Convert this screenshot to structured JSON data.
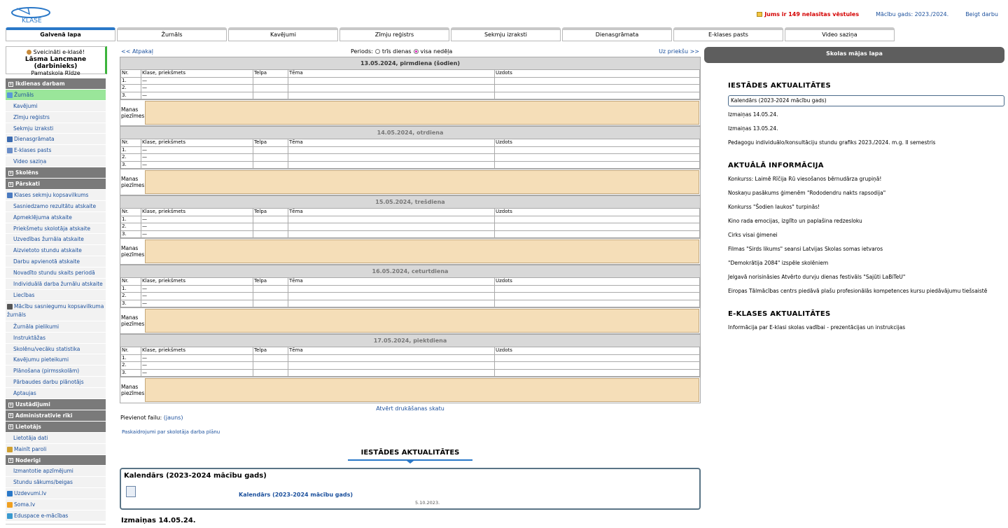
{
  "header": {
    "logo_text": "KLASE",
    "messages": "Jums ir 149 nelasītas vēstules",
    "school_year": "Mācību gads: 2023./2024.",
    "logout": "Beigt darbu"
  },
  "tabs": [
    {
      "label": "Galvenā lapa"
    },
    {
      "label": "Žurnāls"
    },
    {
      "label": "Kavējumi"
    },
    {
      "label": "Zīmju reģistrs"
    },
    {
      "label": "Sekmju izraksti"
    },
    {
      "label": "Dienasgrāmata"
    },
    {
      "label": "E-klases pasts"
    },
    {
      "label": "Video saziņa"
    }
  ],
  "greeting": {
    "hello": "Sveicināti e-klasē!",
    "name": "Lāsma Lancmane (darbinieks)",
    "school": "Pamatskola Rīdze"
  },
  "menu": [
    {
      "type": "head",
      "label": "Ikdienas darbam"
    },
    {
      "type": "item",
      "label": "Žurnāls",
      "icon": "journal-icon",
      "active": true
    },
    {
      "type": "item",
      "label": "Kavējumi"
    },
    {
      "type": "item",
      "label": "Zīmju reģistrs"
    },
    {
      "type": "item",
      "label": "Sekmju izraksti"
    },
    {
      "type": "item",
      "label": "Dienasgrāmata",
      "icon": "diary-icon"
    },
    {
      "type": "item",
      "label": "E-klases pasts",
      "icon": "mail-icon"
    },
    {
      "type": "item",
      "label": "Video saziņa"
    },
    {
      "type": "head",
      "label": "Skolēns"
    },
    {
      "type": "head",
      "label": "Pārskati"
    },
    {
      "type": "item",
      "label": "Klases sekmju kopsavilkums",
      "icon": "chart-icon"
    },
    {
      "type": "item",
      "label": "Sasniedzamo rezultātu atskaite"
    },
    {
      "type": "item",
      "label": "Apmeklējuma atskaite"
    },
    {
      "type": "item",
      "label": "Priekšmetu skolotāja atskaite"
    },
    {
      "type": "item",
      "label": "Uzvedības žurnāla atskaite"
    },
    {
      "type": "item",
      "label": "Aizvietoto stundu atskaite"
    },
    {
      "type": "item",
      "label": "Darbu apvienotā atskaite"
    },
    {
      "type": "item",
      "label": "Novadīto stundu skaits periodā"
    },
    {
      "type": "item",
      "label": "Individuālā darba žurnālu atskaite"
    },
    {
      "type": "item",
      "label": "Liecības"
    },
    {
      "type": "item",
      "label": "Mācību sasniegumu kopsavilkuma žurnāls",
      "icon": "sigma-icon",
      "tall": true
    },
    {
      "type": "item",
      "label": "Žurnāla pielikumi"
    },
    {
      "type": "item",
      "label": "Instruktāžas"
    },
    {
      "type": "item",
      "label": "Skolēnu/vecāku statistika"
    },
    {
      "type": "item",
      "label": "Kavējumu pieteikumi"
    },
    {
      "type": "item",
      "label": "Plānošana (pirmsskolām)"
    },
    {
      "type": "item",
      "label": "Pārbaudes darbu plānotājs"
    },
    {
      "type": "item",
      "label": "Aptaujas"
    },
    {
      "type": "head",
      "label": "Uzstādījumi"
    },
    {
      "type": "head",
      "label": "Administratīvie rīki"
    },
    {
      "type": "head",
      "label": "Lietotājs"
    },
    {
      "type": "item",
      "label": "Lietotāja dati"
    },
    {
      "type": "item",
      "label": "Mainīt paroli",
      "icon": "key-icon"
    },
    {
      "type": "head",
      "label": "Noderīgi"
    },
    {
      "type": "item",
      "label": "Izmantotie apzīmējumi"
    },
    {
      "type": "item",
      "label": "Stundu sākums/beigas"
    },
    {
      "type": "item",
      "label": "Uzdevumi.lv",
      "icon": "book-icon"
    },
    {
      "type": "item",
      "label": "Soma.lv",
      "icon": "bag-icon"
    },
    {
      "type": "item",
      "label": "Eduspace e-mācības",
      "icon": "globe-icon"
    }
  ],
  "main": {
    "prev": "<< Atpakaļ",
    "next": "Uz priekšu >>",
    "period_label": "Periods:",
    "period_opt1": "trīs dienas",
    "period_opt2": "visa nedēļa",
    "columns": [
      "Nr.",
      "Klase, priekšmets",
      "Telpa",
      "Tēma",
      "Uzdots"
    ],
    "notes_label": "Manas piezīmes:",
    "days": [
      {
        "title": "13.05.2024, pirmdiena (šodien)",
        "today": true
      },
      {
        "title": "14.05.2024, otrdiena"
      },
      {
        "title": "15.05.2024, trešdiena"
      },
      {
        "title": "16.05.2024, ceturtdiena"
      },
      {
        "title": "17.05.2024, piektdiena"
      }
    ],
    "rows": [
      {
        "nr": "1.",
        "subj": "—"
      },
      {
        "nr": "2.",
        "subj": "—"
      },
      {
        "nr": "3.",
        "subj": "—"
      }
    ],
    "print_link": "Atvērt drukāšanas skatu",
    "attach_label": "Pievienot failu:",
    "attach_link": "(jauns)",
    "explain_link": "Paskaidrojumi par skolotāja darba plānu",
    "news_heading": "IESTĀDES AKTUALITĀTES",
    "card_title": "Kalendārs (2023-2024 mācību gads)",
    "card_link": "Kalendārs (2023-2024 mācību gads)",
    "card_date": "5.10.2023.",
    "news2_title": "Izmaiņas 14.05.24."
  },
  "right": {
    "school_button": "Skolas mājas lapa",
    "sec1": "IESTĀDES AKTUALITĀTES",
    "sec1_items": [
      "Kalendārs (2023-2024 mācību gads)",
      "Izmaiņas 14.05.24.",
      "Izmaiņas 13.05.24.",
      "Pedagogu individuālo/konsultāciju stundu grafiks 2023./2024. m.g. II semestris"
    ],
    "sec2": "AKTUĀLĀ INFORMĀCIJA",
    "sec2_items": [
      "Konkurss: Laimē Rīčija Rū viesošanos bērnudārza grupiņā!",
      "Noskaņu pasākums ģimenēm \"Rododendru nakts rapsodija\"",
      "Konkurss \"Šodien laukos\" turpinās!",
      "Kino rada emocijas, izglīto un paplašina redzesloku",
      "Cirks visai ģimenei",
      "Filmas \"Sirds likums\" seansi Latvijas Skolas somas ietvaros",
      "\"Demokrātija 2084\" izspēle skolēniem",
      "Jelgavā norisināsies Atvērto durvju dienas festivāls \"Sajūti LaBiTeU\"",
      "Eiropas Tālmācības centrs piedāvā plašu profesionālās kompetences kursu piedāvājumu tiešsaistē"
    ],
    "sec3": "E-KLASES AKTUALITĀTES",
    "sec3_items": [
      "Informācija par E-klasi skolas vadībai - prezentācijas un instrukcijas"
    ]
  }
}
